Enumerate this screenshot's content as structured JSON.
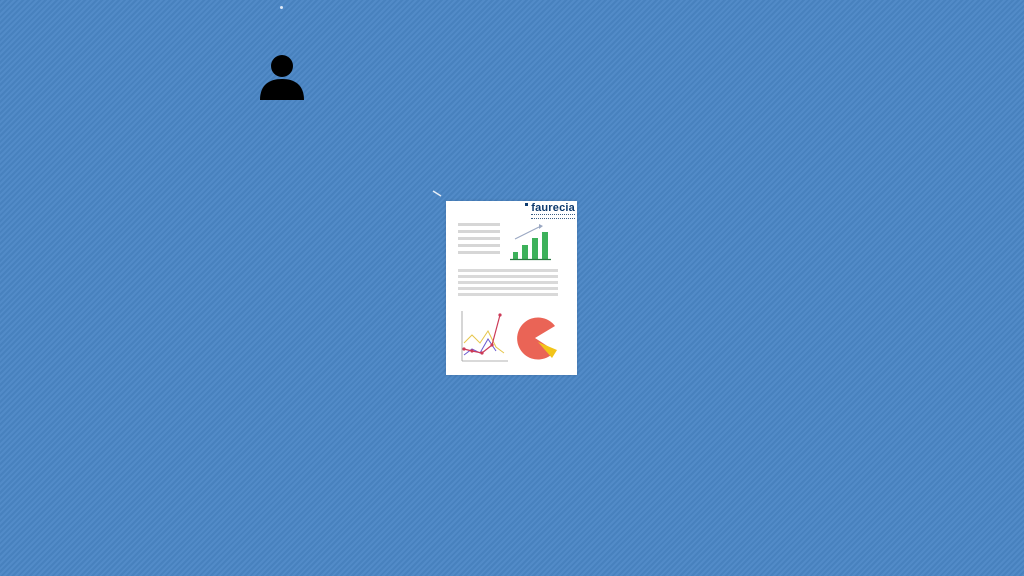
{
  "logo": {
    "brand": "faurecia"
  },
  "colors": {
    "background": "#4a86c5",
    "document": "#ffffff",
    "logo_text": "#0f3b6e",
    "bar": "#3cb15a",
    "line_red": "#cc3a57",
    "line_yellow": "#e6c54a",
    "line_purple": "#6a5ad0",
    "pie_red": "#ea6456",
    "pie_yellow": "#f2c419"
  },
  "icons": {
    "user": "user-icon",
    "document": "report-document-icon"
  }
}
